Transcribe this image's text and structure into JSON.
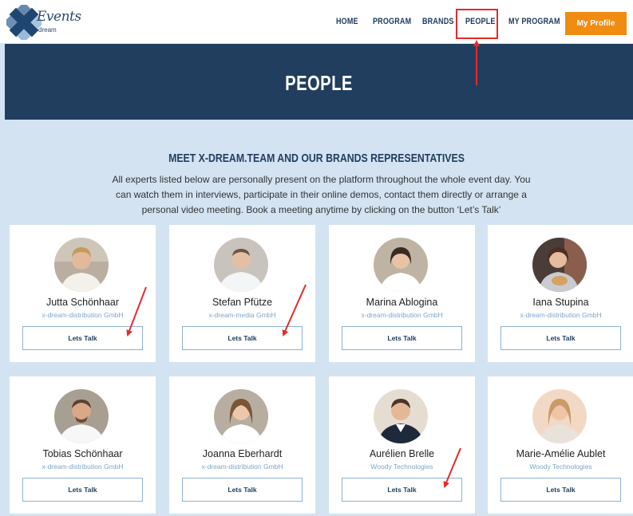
{
  "logo": {
    "script_text": "Events",
    "sub_text": "dream"
  },
  "nav": {
    "items": [
      {
        "label": "HOME"
      },
      {
        "label": "PROGRAM"
      },
      {
        "label": "BRANDS"
      },
      {
        "label": "PEOPLE"
      },
      {
        "label": "MY PROGRAM"
      }
    ],
    "profile_label": "My Profile"
  },
  "hero": {
    "title": "PEOPLE"
  },
  "intro": {
    "title": "MEET X-DREAM.TEAM AND OUR BRANDS REPRESENTATIVES",
    "text": "All experts listed below are personally present on the platform throughout the whole event day. You can watch them in interviews, participate in their online demos, contact them directly or arrange a personal video meeting. Book a meeting anytime by clicking on the button ‘Let’s Talk’"
  },
  "people": [
    {
      "name": "Jutta Schönhaar",
      "company": "x-dream-distribution GmbH",
      "button": "Lets Talk"
    },
    {
      "name": "Stefan Pfütze",
      "company": "x-dream-media GmbH",
      "button": "Lets Talk"
    },
    {
      "name": "Marina Ablogina",
      "company": "x-dream-distribution GmbH",
      "button": "Lets Talk"
    },
    {
      "name": "Iana Stupina",
      "company": "x-dream-distribution GmbH",
      "button": "Lets Talk"
    },
    {
      "name": "Tobias Schönhaar",
      "company": "x-dream-distribution GmbH",
      "button": "Lets Talk"
    },
    {
      "name": "Joanna Eberhardt",
      "company": "x-dream-distribution GmbH",
      "button": "Lets Talk"
    },
    {
      "name": "Aurélien Brelle",
      "company": "Woody Technologies",
      "button": "Lets Talk"
    },
    {
      "name": "Marie-Amélie Aublet",
      "company": "Woody Technologies",
      "button": "Lets Talk"
    }
  ],
  "colors": {
    "accent": "#f08c12",
    "navy": "#213e5f",
    "page_bg": "#d3e3f1",
    "annotation": "#e32b2b"
  }
}
